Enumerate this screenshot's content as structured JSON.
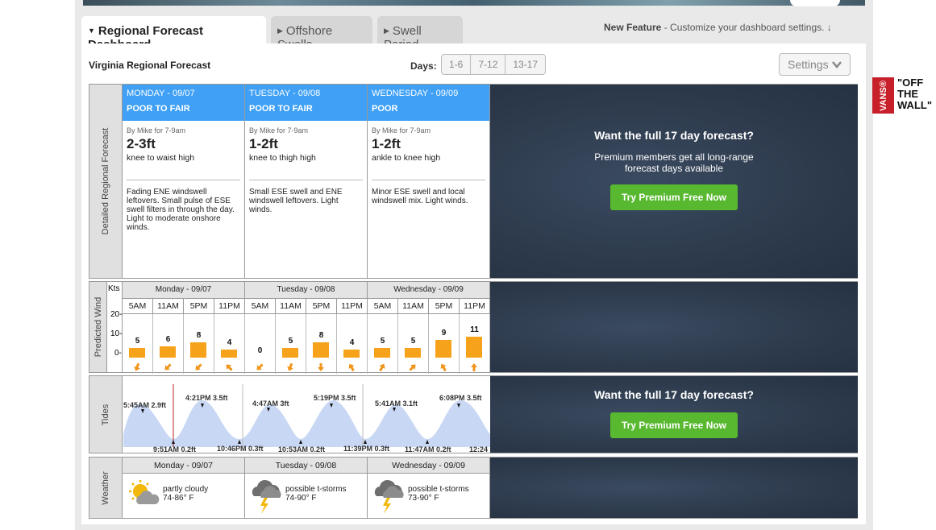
{
  "tabs": [
    {
      "label": "Regional Forecast Dashboard",
      "active": true
    },
    {
      "label": "Offshore Swells",
      "active": false
    },
    {
      "label": "Swell Period",
      "active": false
    }
  ],
  "new_feature": {
    "label": "New Feature",
    "text": " - Customize your dashboard settings."
  },
  "region_title": "Virginia Regional Forecast",
  "days": {
    "label": "Days:",
    "options": [
      "1-6",
      "7-12",
      "13-17"
    ]
  },
  "settings_label": "Settings",
  "sections": {
    "detailed": "Detailed Regional Forecast",
    "wind": "Predicted Wind",
    "tides": "Tides",
    "weather": "Weather"
  },
  "forecast_days": [
    {
      "date": "MONDAY - 09/07",
      "condition": "POOR TO FAIR",
      "byline": "By Mike for 7-9am",
      "size": "2-3ft",
      "desc": "knee to waist high",
      "notes": "Fading ENE windswell leftovers. Small pulse of ESE swell filters in through the day. Light to moderate onshore winds."
    },
    {
      "date": "TUESDAY - 09/08",
      "condition": "POOR TO FAIR",
      "byline": "By Mike for 7-9am",
      "size": "1-2ft",
      "desc": "knee to thigh high",
      "notes": "Small ESE swell and ENE windswell leftovers. Light winds."
    },
    {
      "date": "WEDNESDAY - 09/09",
      "condition": "POOR",
      "byline": "By Mike for 7-9am",
      "size": "1-2ft",
      "desc": "ankle to knee high",
      "notes": "Minor ESE swell and local windswell mix. Light winds."
    }
  ],
  "premium": {
    "title": "Want the full 17 day forecast?",
    "line1": "Premium members get all long-range",
    "line2": "forecast days available",
    "button": "Try Premium Free Now"
  },
  "wind": {
    "unit": "Kts",
    "axis": [
      "20-",
      "10-",
      "0-"
    ],
    "days": [
      "Monday - 09/07",
      "Tuesday - 09/08",
      "Wednesday - 09/09"
    ],
    "times": [
      "5AM",
      "11AM",
      "5PM",
      "11PM"
    ],
    "values": [
      "5",
      "6",
      "8",
      "4",
      "0",
      "5",
      "8",
      "4",
      "5",
      "5",
      "9",
      "11"
    ],
    "arrow_rotation_deg": [
      200,
      225,
      225,
      315,
      225,
      200,
      180,
      330,
      30,
      45,
      330,
      0
    ],
    "bar_color": "#f7a21b"
  },
  "tides": {
    "highs": [
      "5:45AM 2.9ft",
      "4:21PM 3.5ft",
      "4:47AM 3ft",
      "5:19PM 3.5ft",
      "5:41AM 3.1ft",
      "6:08PM 3.5ft"
    ],
    "lows": [
      "9:51AM 0.2ft",
      "10:46PM 0.3ft",
      "10:53AM 0.2ft",
      "11:39PM 0.3ft",
      "11:47AM 0.2ft",
      "12:24"
    ]
  },
  "weather": [
    {
      "date": "Monday - 09/07",
      "desc": "partly cloudy",
      "temp": "74-86° F",
      "icon": "partly-cloudy-icon"
    },
    {
      "date": "Tuesday - 09/08",
      "desc": "possible t-storms",
      "temp": "74-90° F",
      "icon": "thunderstorm-icon"
    },
    {
      "date": "Wednesday - 09/09",
      "desc": "possible t-storms",
      "temp": "73-90° F",
      "icon": "thunderstorm-icon"
    }
  ],
  "ad": {
    "brand": "VANS®",
    "line1": "\"OFF",
    "line2": "THE",
    "line3": "WALL\""
  },
  "colors": {
    "header_blue": "#3fa0f5",
    "premium_green": "#58b830",
    "premium_bg": "#2d3a4c"
  }
}
